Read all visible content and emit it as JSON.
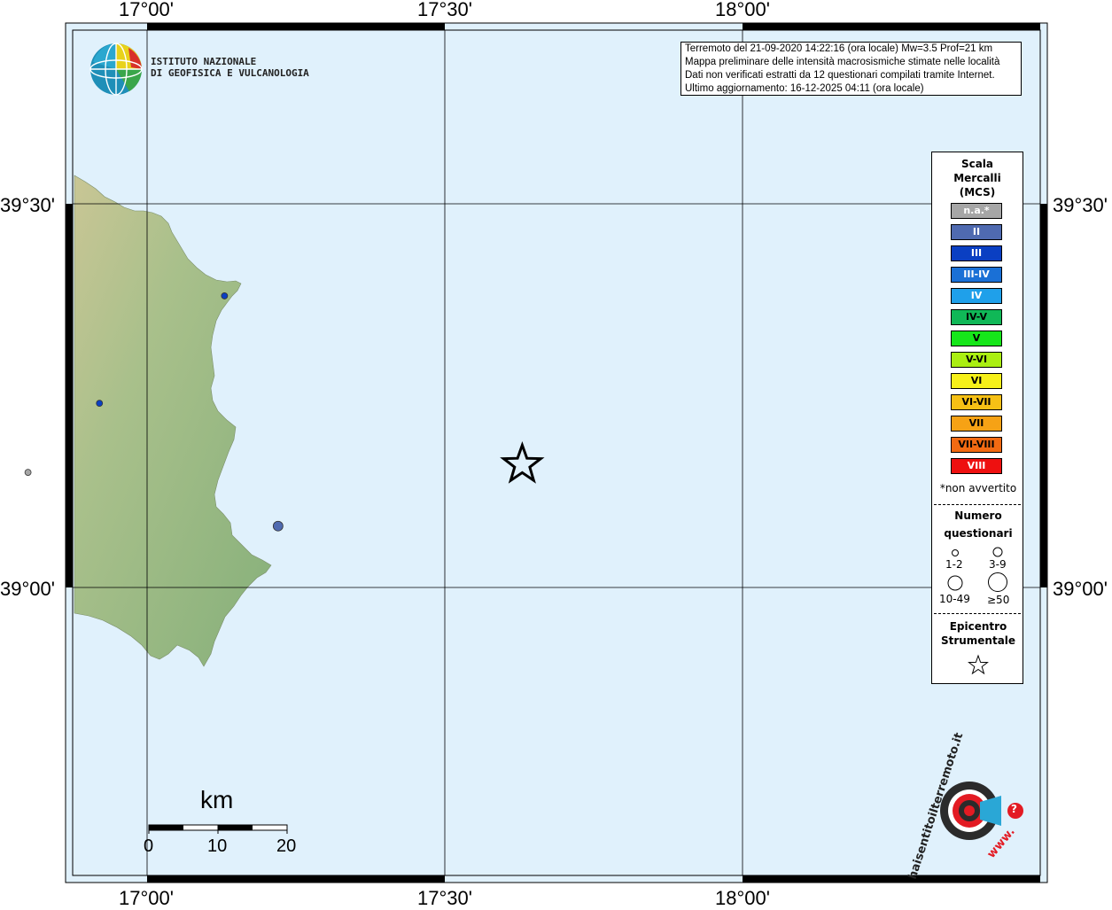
{
  "map": {
    "lon_ticks": [
      "17°00'",
      "17°30'",
      "18°00'"
    ],
    "lat_ticks": [
      "39°30'",
      "39°00'"
    ]
  },
  "info": {
    "line1": "Terremoto del 21-09-2020 14:22:16 (ora locale) Mw=3.5 Prof=21 km",
    "line2": "Mappa preliminare delle intensità macrosismiche stimate nelle località",
    "line3": "Dati non verificati estratti da 12 questionari compilati tramite Internet.",
    "line4": "Ultimo aggiornamento: 16-12-2025 04:11 (ora locale)"
  },
  "logo": {
    "line1": "ISTITUTO NAZIONALE",
    "line2": "DI GEOFISICA E VULCANOLOGIA"
  },
  "legend": {
    "title1": "Scala",
    "title2": "Mercalli",
    "title3": "(MCS)",
    "intensities": [
      {
        "label": "n.a.*",
        "color": "#a6a6a6",
        "text": "#ffffff"
      },
      {
        "label": "II",
        "color": "#4f6ab0",
        "text": "#ffffff"
      },
      {
        "label": "III",
        "color": "#0a3fc2",
        "text": "#ffffff"
      },
      {
        "label": "III-IV",
        "color": "#1a70d6",
        "text": "#ffffff"
      },
      {
        "label": "IV",
        "color": "#1fa0ea",
        "text": "#ffffff"
      },
      {
        "label": "IV-V",
        "color": "#10b857",
        "text": "#000000"
      },
      {
        "label": "V",
        "color": "#16e61a",
        "text": "#000000"
      },
      {
        "label": "V-VI",
        "color": "#aaee12",
        "text": "#000000"
      },
      {
        "label": "VI",
        "color": "#f6f019",
        "text": "#000000"
      },
      {
        "label": "VI-VII",
        "color": "#f6c015",
        "text": "#000000"
      },
      {
        "label": "VII",
        "color": "#f6a215",
        "text": "#000000"
      },
      {
        "label": "VII-VIII",
        "color": "#f26a12",
        "text": "#000000"
      },
      {
        "label": "VIII",
        "color": "#ee1010",
        "text": "#ffffff"
      }
    ],
    "note": "*non avvertito",
    "num_title1": "Numero",
    "num_title2": "questionari",
    "sizes": [
      "1-2",
      "3-9",
      "10-49",
      "≥50"
    ],
    "epi_title1": "Epicentro",
    "epi_title2": "Strumentale"
  },
  "scalebar": {
    "unit": "km",
    "labels": [
      "0",
      "10",
      "20"
    ]
  },
  "points": [
    {
      "lon": 17.13,
      "lat": 39.38,
      "intensity": "III",
      "count": "1-2"
    },
    {
      "lon": 16.92,
      "lat": 39.24,
      "intensity": "III",
      "count": "1-2"
    },
    {
      "lon": 16.8,
      "lat": 39.15,
      "intensity": "n.a.*",
      "count": "1-2"
    },
    {
      "lon": 17.22,
      "lat": 39.08,
      "intensity": "II",
      "count": "3-9"
    }
  ],
  "epicenter": {
    "lon": 17.63,
    "lat": 39.16
  },
  "badge": {
    "ring_text": "haisentitoilterremoto.it",
    "www": "www.",
    "q": "?"
  },
  "colors": {
    "sea": "#e0f1fc",
    "land": "#8fb37a",
    "frame": "#000000"
  }
}
